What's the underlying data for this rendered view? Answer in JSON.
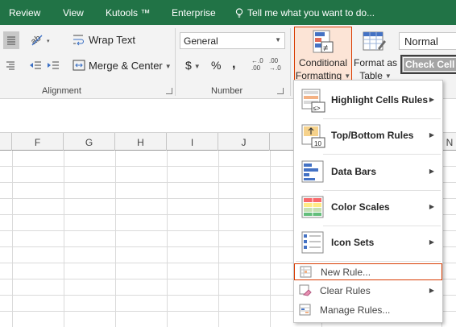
{
  "tabs": [
    "Review",
    "View",
    "Kutools ™",
    "Enterprise"
  ],
  "tell_me": "Tell me what you want to do...",
  "alignment": {
    "wrap_text": "Wrap Text",
    "merge_center": "Merge & Center",
    "group_label": "Alignment"
  },
  "number": {
    "format_value": "General",
    "currency_symbol": "$",
    "percent_symbol": "%",
    "comma_symbol": ",",
    "inc_decimal_top": "←.0",
    "inc_decimal_bottom": ".00",
    "dec_decimal_top": ".00",
    "dec_decimal_bottom": "→.0",
    "group_label": "Number"
  },
  "styles": {
    "conditional_formatting_line1": "Conditional",
    "conditional_formatting_line2": "Formatting",
    "format_as_table_line1": "Format as",
    "format_as_table_line2": "Table",
    "normal": "Normal",
    "check_cell": "Check Cell"
  },
  "columns": [
    "F",
    "G",
    "H",
    "I",
    "J",
    "N"
  ],
  "menu": {
    "highlight_cells_rules": "Highlight Cells Rules",
    "top_bottom_rules": "Top/Bottom Rules",
    "data_bars": "Data Bars",
    "color_scales": "Color Scales",
    "icon_sets": "Icon Sets",
    "new_rule": "New Rule...",
    "clear_rules": "Clear Rules",
    "manage_rules": "Manage Rules..."
  },
  "colors": {
    "title_bar": "#217346",
    "ribbon": "#f3f3f3",
    "highlight_border": "#d83b01",
    "highlight_fill": "#fce4d6"
  }
}
